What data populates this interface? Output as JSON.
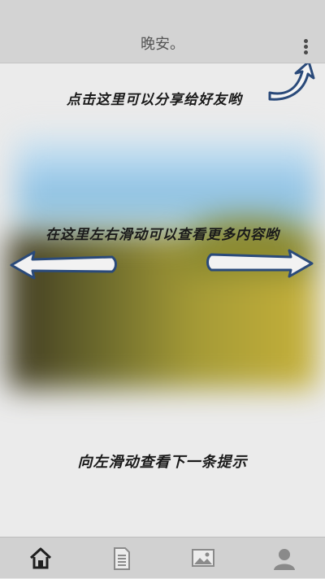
{
  "header": {
    "title": "晚安。",
    "more_icon": "more-vertical-icon"
  },
  "hints": {
    "share": "点击这里可以分享给好友哟",
    "swipe_content": "在这里左右滑动可以查看更多内容哟",
    "swipe_next": "向左滑动查看下一条提示"
  },
  "bottom_nav": {
    "items": [
      {
        "icon": "home-icon",
        "active": true
      },
      {
        "icon": "document-icon",
        "active": false
      },
      {
        "icon": "image-icon",
        "active": false
      },
      {
        "icon": "user-icon",
        "active": false
      }
    ]
  },
  "colors": {
    "header_bg": "#d3d3d3",
    "nav_bg": "#d1d1d1",
    "arrow_stroke": "#2a4a7a",
    "icon_active": "#1f1f1f",
    "icon_inactive": "#8a8a8a"
  }
}
